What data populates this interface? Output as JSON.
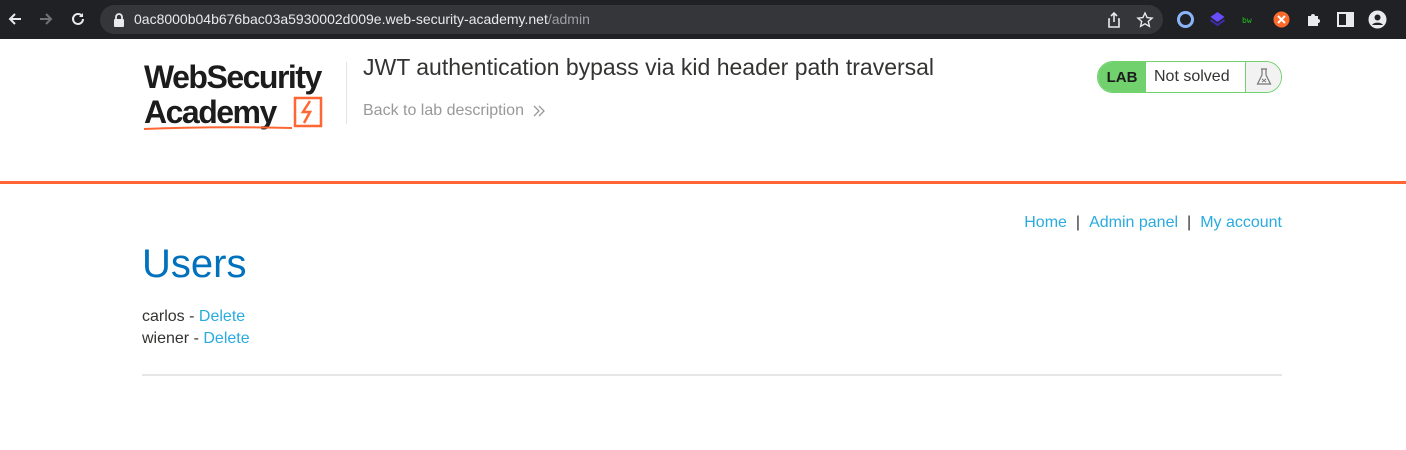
{
  "browser": {
    "url_host": "0ac8000b04b676bac03a5930002d009e.web-security-academy.net",
    "url_path": "/admin"
  },
  "header": {
    "logo_line1": "WebSecurity",
    "logo_line2": "Academy",
    "lab_title": "JWT authentication bypass via kid header path traversal",
    "back_link": "Back to lab description",
    "lab_badge": "LAB",
    "lab_status": "Not solved"
  },
  "nav": {
    "home": "Home",
    "admin_panel": "Admin panel",
    "my_account": "My account",
    "separator": "|"
  },
  "main": {
    "heading": "Users",
    "users": [
      {
        "name": "carlos",
        "dash": " - ",
        "action": "Delete"
      },
      {
        "name": "wiener",
        "dash": " - ",
        "action": "Delete"
      }
    ]
  },
  "colors": {
    "accent_orange": "#ff6633",
    "link_blue": "#29abe0",
    "heading_blue": "#0071bc",
    "lab_green": "#70d16d"
  }
}
